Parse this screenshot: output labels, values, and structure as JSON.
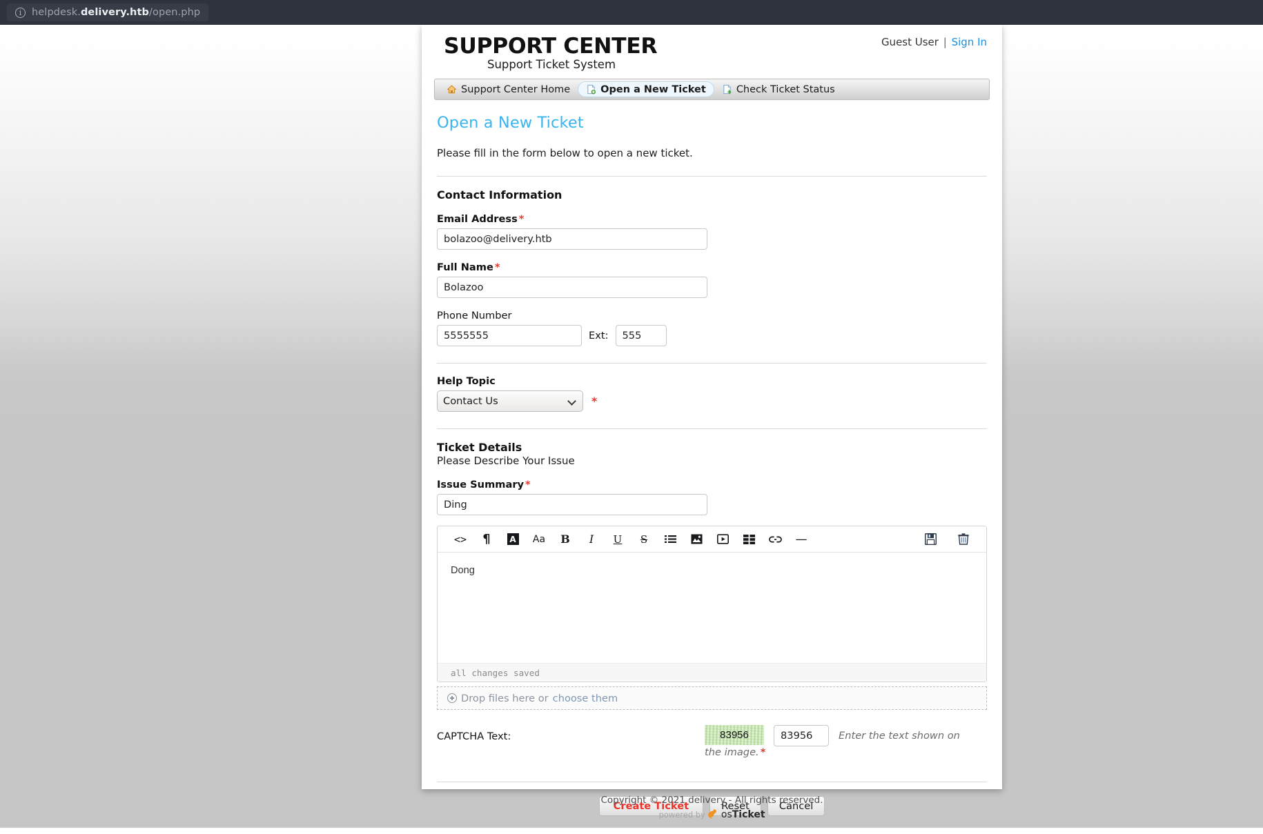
{
  "browser": {
    "info_icon": "info-icon",
    "url_prefix": "helpdesk.",
    "url_domain": "delivery.htb",
    "url_path": "/open.php"
  },
  "header": {
    "logo_title": "SUPPORT CENTER",
    "logo_subtitle": "Support Ticket System",
    "user_label": "Guest User",
    "separator": "|",
    "sign_in_label": "Sign In"
  },
  "nav": {
    "tabs": [
      {
        "label": "Support Center Home",
        "icon": "home-icon",
        "active": false
      },
      {
        "label": "Open a New Ticket",
        "icon": "new-ticket-icon",
        "active": true
      },
      {
        "label": "Check Ticket Status",
        "icon": "ticket-status-icon",
        "active": false
      }
    ]
  },
  "page": {
    "title": "Open a New Ticket",
    "lead": "Please fill in the form below to open a new ticket."
  },
  "contact_section": {
    "heading": "Contact Information",
    "email": {
      "label": "Email Address",
      "required": "*",
      "value": "bolazoo@delivery.htb"
    },
    "full_name": {
      "label": "Full Name",
      "required": "*",
      "value": "Bolazoo"
    },
    "phone": {
      "label": "Phone Number",
      "value": "5555555",
      "ext_label": "Ext:",
      "ext_value": "555"
    }
  },
  "help_topic": {
    "label": "Help Topic",
    "required": "*",
    "selected": "Contact Us",
    "options": [
      "Contact Us"
    ]
  },
  "ticket_details": {
    "heading": "Ticket Details",
    "subheading": "Please Describe Your Issue",
    "summary": {
      "label": "Issue Summary",
      "required": "*",
      "value": "Ding"
    },
    "editor": {
      "body": "Dong",
      "status": "all changes saved",
      "toolbar": [
        {
          "name": "source-code-icon",
          "glyph": "<>"
        },
        {
          "name": "paragraph-icon",
          "glyph": "¶"
        },
        {
          "name": "text-color-icon",
          "glyph": "A"
        },
        {
          "name": "font-size-icon",
          "glyph": "Aa"
        },
        {
          "name": "bold-icon",
          "glyph": "B"
        },
        {
          "name": "italic-icon",
          "glyph": "I"
        },
        {
          "name": "underline-icon",
          "glyph": "U"
        },
        {
          "name": "strikethrough-icon",
          "glyph": "S"
        },
        {
          "name": "bullet-list-icon",
          "glyph": "list"
        },
        {
          "name": "image-icon",
          "glyph": "image"
        },
        {
          "name": "video-icon",
          "glyph": "video"
        },
        {
          "name": "table-icon",
          "glyph": "table"
        },
        {
          "name": "link-icon",
          "glyph": "link"
        },
        {
          "name": "horizontal-rule-icon",
          "glyph": "—"
        }
      ],
      "save_icon": "save-icon",
      "delete_icon": "trash-icon"
    },
    "dropzone": {
      "text": "Drop files here or",
      "link": "choose them",
      "icon": "add-file-icon"
    }
  },
  "captcha": {
    "label": "CAPTCHA Text:",
    "image_text": "83956",
    "value": "83956",
    "hint_line1": "Enter the text shown on",
    "hint_line2": "the image.",
    "required": "*"
  },
  "actions": {
    "create_label": "Create Ticket",
    "reset_label": "Reset",
    "cancel_label": "Cancel"
  },
  "footer": {
    "copyright": "Copyright © 2021 delivery - All rights reserved.",
    "powered_by": "powered by",
    "brand_os": "os",
    "brand_ticket": "Ticket"
  },
  "colors": {
    "accent": "#3ab4ef",
    "link": "#1b8ee0",
    "required": "#e23b2e",
    "primary_button_text": "#e8342a",
    "chrome": "#2f333d",
    "page_bg": "#c6c6c6"
  }
}
